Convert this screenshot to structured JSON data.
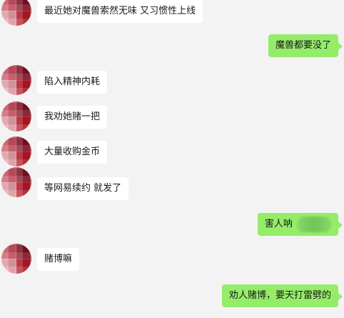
{
  "messages": [
    {
      "side": "left",
      "text": "最近她对魔兽索然无味 又习惯性上线"
    },
    {
      "side": "right",
      "text": "魔兽都要没了"
    },
    {
      "side": "left",
      "text": "陷入精神内耗"
    },
    {
      "side": "left",
      "text": "我劝她赌一把"
    },
    {
      "side": "left",
      "text": "大量收购金币"
    },
    {
      "side": "left",
      "text": "等网易续约 就发了"
    },
    {
      "side": "right",
      "text": "害人呐"
    },
    {
      "side": "left",
      "text": "赌博嘛"
    },
    {
      "side": "right",
      "text": "劝人赌博，要天打雷劈的"
    }
  ],
  "colors": {
    "background": "#f3f3f3",
    "left_bubble": "#ffffff",
    "right_bubble": "#95ec69"
  }
}
